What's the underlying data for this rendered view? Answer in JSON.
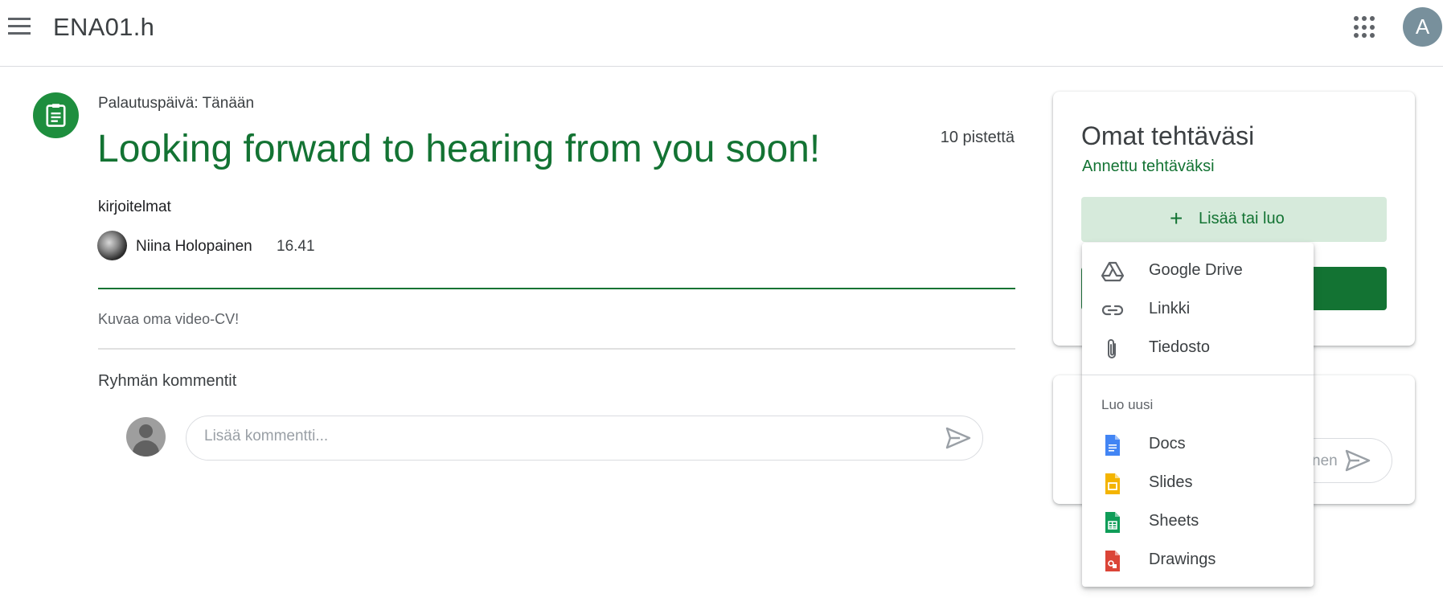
{
  "header": {
    "title": "ENA01.h",
    "avatar_letter": "A"
  },
  "assignment": {
    "due": "Palautuspäivä: Tänään",
    "title": "Looking forward to hearing from you soon!",
    "points": "10 pistettä",
    "topic": "kirjoitelmat",
    "author": "Niina Holopainen",
    "time": "16.41",
    "description": "Kuvaa oma video-CV!"
  },
  "comments": {
    "heading": "Ryhmän kommentit",
    "placeholder": "Lisää kommentti..."
  },
  "your_work": {
    "title": "Omat tehtäväsi",
    "status": "Annettu tehtäväksi",
    "add_label": "Lisää tai luo",
    "private_placeholder_fragment": "nen"
  },
  "add_menu": {
    "items": [
      {
        "label": "Google Drive",
        "icon": "google-drive-icon"
      },
      {
        "label": "Linkki",
        "icon": "link-icon"
      },
      {
        "label": "Tiedosto",
        "icon": "paperclip-icon"
      }
    ],
    "create_heading": "Luo uusi",
    "create_items": [
      {
        "label": "Docs",
        "icon": "docs-icon",
        "color": "#4285f4"
      },
      {
        "label": "Slides",
        "icon": "slides-icon",
        "color": "#f4b400"
      },
      {
        "label": "Sheets",
        "icon": "sheets-icon",
        "color": "#0f9d58"
      },
      {
        "label": "Drawings",
        "icon": "drawings-icon",
        "color": "#db4437"
      }
    ]
  },
  "colors": {
    "accent_green": "#137333",
    "light_green": "#d6eadb"
  }
}
